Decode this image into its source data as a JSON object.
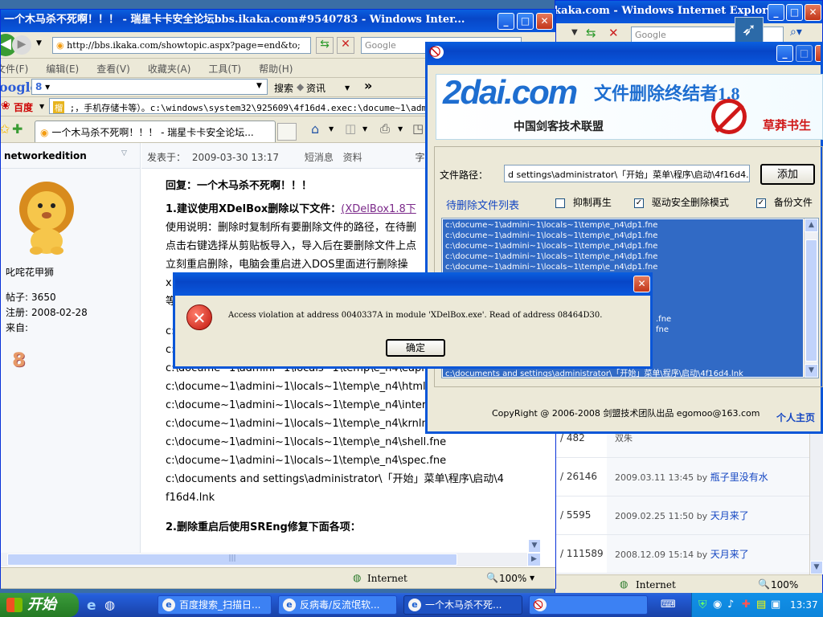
{
  "desktop": {
    "background": "#3a6ea5"
  },
  "bg_window": {
    "title": "反病毒/反流氓软件论坛 - 瑞星卡卡安全论坛bbs.ikaka.com - Windows Internet Explorer",
    "search_placeholder": "Google",
    "status": "Internet",
    "zoom": "100%",
    "forum_rows": [
      {
        "count": "/ 482",
        "last": "双朱",
        "by": "",
        "user": ""
      },
      {
        "count": "/ 26146",
        "last": "2009.03.11 13:45",
        "by": "by",
        "user": "瓶子里没有水"
      },
      {
        "count": "/ 5595",
        "last": "2009.02.25 11:50",
        "by": "by",
        "user": "天月来了"
      },
      {
        "count": "/ 111589",
        "last": "2008.12.09 15:14",
        "by": "by",
        "user": "天月来了"
      }
    ]
  },
  "ie": {
    "title": "一个木马杀不死啊！！！ - 瑞星卡卡安全论坛bbs.ikaka.com#9540783 - Windows Inter...",
    "address": "http://bbs.ikaka.com/showtopic.aspx?page=end&to;",
    "search_placeholder": "Google",
    "menu": [
      "文件(F)",
      "编辑(E)",
      "查看(V)",
      "收藏夹(A)",
      "工具(T)",
      "帮助(H)"
    ],
    "google_brand": "oogle",
    "google_g": "8",
    "search_btn": "搜索",
    "info_btn": "资讯",
    "more": "»",
    "baidu_label": "百度",
    "baidu_text": ";，手机存储卡等）。c:\\windows\\system32\\925609\\4f16d4.exec:\\docume~1\\admini~",
    "tab_title": "一个木马杀不死啊！！！ - 瑞星卡卡安全论坛...",
    "status": "Internet",
    "zoom": "100%"
  },
  "post": {
    "author": "networkedition",
    "author_label": "叱咤花甲狮",
    "stats": [
      {
        "label": "帖子:",
        "value": "3650"
      },
      {
        "label": "注册:",
        "value": "2008-02-28"
      },
      {
        "label": "来自:",
        "value": ""
      }
    ],
    "medal": "8",
    "posted_label": "发表于：",
    "posted_at": "2009-03-30 13:17",
    "msg_link": "短消息",
    "profile_link": "资料",
    "font_label": "字号：",
    "reply_title": "回复：一个木马杀不死啊！！！",
    "step1_title": "1.建议使用XDelBox删除以下文件：",
    "step1_link": "(XDelBox1.8下",
    "lines": [
      "使用说明：删除时复制所有要删除文件的路径，在待删",
      "点击右键选择从剪贴板导入，导入后在要删除文件上点",
      "立刻重启删除，电脑会重启进入DOS里面进行删除操",
      "xp",
      "等"
    ],
    "files": [
      "c:",
      "c:",
      "c:\\docume~1\\admini~1\\locals~1\\temp\\e_n4\\eapi.fne",
      "c:\\docume~1\\admini~1\\locals~1\\temp\\e_n4\\htmlvie",
      "c:\\docume~1\\admini~1\\locals~1\\temp\\e_n4\\internet",
      "c:\\docume~1\\admini~1\\locals~1\\temp\\e_n4\\krnln.fn",
      "c:\\docume~1\\admini~1\\locals~1\\temp\\e_n4\\shell.fne",
      "c:\\docume~1\\admini~1\\locals~1\\temp\\e_n4\\spec.fne",
      "c:\\documents and settings\\administrator\\「开始」菜单\\程序\\启动\\4",
      "f16d4.lnk"
    ],
    "step2_title": "2.删除重启后使用SREng修复下面各项："
  },
  "xdel": {
    "logo_main": "2dai.com",
    "logo_sub": "中国剑客技术联盟",
    "app_title": "文件删除终结者1.8",
    "author_tag": "草莽书生",
    "path_label": "文件路径：",
    "path_value": "d settings\\administrator\\「开始」菜单\\程序\\启动\\4f16d4.lnk",
    "add_btn": "添加",
    "list_title": "待删除文件列表",
    "opt_regen": "抑制再生",
    "opt_driver": "驱动安全删除模式",
    "opt_backup": "备份文件",
    "opt_regen_checked": false,
    "opt_driver_checked": true,
    "opt_backup_checked": true,
    "list_items": [
      "c:\\docume~1\\admini~1\\locals~1\\temp\\e_n4\\dp1.fne",
      "c:\\docume~1\\admini~1\\locals~1\\temp\\e_n4\\dp1.fne",
      "c:\\docume~1\\admini~1\\locals~1\\temp\\e_n4\\dp1.fne",
      "c:\\docume~1\\admini~1\\locals~1\\temp\\e_n4\\dp1.fne",
      "c:\\docume~1\\admini~1\\locals~1\\temp\\e_n4\\dp1.fne"
    ],
    "list_tail_1": ".fne",
    "list_tail_2": "fne",
    "list_last": "c:\\documents and settings\\administrator\\「开始」菜单\\程序\\启动\\4f16d4.lnk",
    "copyright": "CopyRight @ 2006-2008  剑盟技术团队出品  egomoo@163.com",
    "homepage": "个人主页",
    "highlight": "#316ac5"
  },
  "dialog": {
    "message": "Access violation at address 0040337A in module 'XDelBox.exe'. Read of address 08464D30.",
    "ok": "确定"
  },
  "taskbar": {
    "start": "开始",
    "tasks": [
      "百度搜索_扫描日...",
      "反病毒/反流氓软...",
      "一个木马杀不死..."
    ],
    "clock": "13:37"
  }
}
